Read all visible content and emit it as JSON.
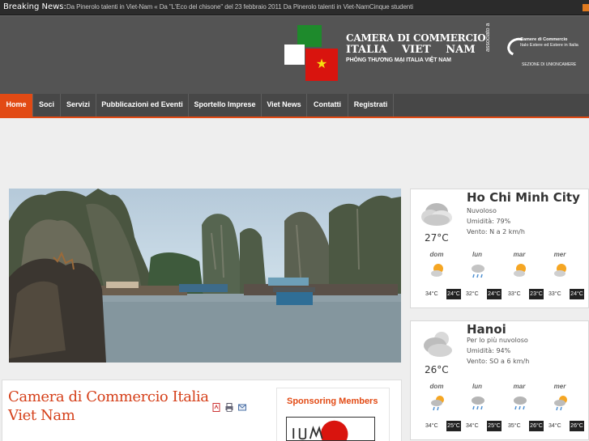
{
  "news": {
    "label": "Breaking News:",
    "text": "Da Pinerolo talenti in Viet-Nam « Da \"L'Eco del chisone\" del 23 febbraio 2011 Da Pinerolo talenti in Viet-NamCinque studenti"
  },
  "header": {
    "title_line1": "CAMERA DI COMMERCIO",
    "title_line2": "ITALIA VIET NAM",
    "title_line3": "PHÒNG THƯƠNG MẠI ITALIA VIỆT NAM",
    "associato": "associato a",
    "uc_line1": "Camere di Commercio",
    "uc_line2": "Italo Estere ed Estere in Italia",
    "uc_line3": "SEZIONE DI UNIONCAMERE"
  },
  "nav": {
    "items": [
      {
        "label": "Home"
      },
      {
        "label": "Soci"
      },
      {
        "label": "Servizi"
      },
      {
        "label": "Pubblicazioni ed Eventi"
      },
      {
        "label": "Sportello Imprese"
      },
      {
        "label": "Viet News"
      },
      {
        "label": "Contatti"
      },
      {
        "label": "Registrati"
      }
    ]
  },
  "weather": [
    {
      "city": "Ho Chi Minh City",
      "condition": "Nuvoloso",
      "humidity": "Umidità: 79%",
      "wind": "Vento: N a 2 km/h",
      "temp": "27°C",
      "days": [
        {
          "name": "dom",
          "lo": "34°C",
          "hi": "24°C",
          "icon": "partly-cloudy-sun-icon"
        },
        {
          "name": "lun",
          "lo": "32°C",
          "hi": "24°C",
          "icon": "rain-icon"
        },
        {
          "name": "mar",
          "lo": "33°C",
          "hi": "23°C",
          "icon": "partly-cloudy-sun-icon"
        },
        {
          "name": "mer",
          "lo": "33°C",
          "hi": "24°C",
          "icon": "partly-cloudy-sun-icon"
        }
      ]
    },
    {
      "city": "Hanoi",
      "condition": "Per lo più nuvoloso",
      "humidity": "Umidità: 94%",
      "wind": "Vento: SO a 6 km/h",
      "temp": "26°C",
      "days": [
        {
          "name": "dom",
          "lo": "34°C",
          "hi": "25°C",
          "icon": "rain-sun-icon"
        },
        {
          "name": "lun",
          "lo": "34°C",
          "hi": "25°C",
          "icon": "rain-icon"
        },
        {
          "name": "mar",
          "lo": "35°C",
          "hi": "26°C",
          "icon": "rain-icon"
        },
        {
          "name": "mer",
          "lo": "34°C",
          "hi": "26°C",
          "icon": "rain-sun-icon"
        }
      ]
    }
  ],
  "content": {
    "title": "Camera di Commercio Italia Viet Nam",
    "sponsor_title": "Sponsoring Members"
  },
  "colors": {
    "accent": "#e24a14",
    "header_bg": "#545454",
    "nav_bg": "#474747",
    "title_red": "#d5401a"
  }
}
